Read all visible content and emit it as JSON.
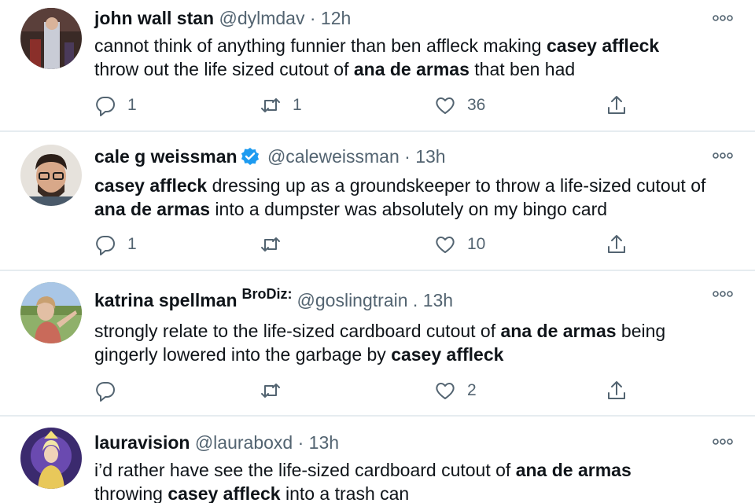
{
  "tweets": [
    {
      "name": "john wall stan",
      "handle": "@dylmdav",
      "separator": "·",
      "time": "12h",
      "verified": false,
      "text_parts": [
        {
          "t": "cannot think of anything funnier than ben affleck making ",
          "b": false
        },
        {
          "t": "casey affleck",
          "b": true
        },
        {
          "t": " throw out the life sized cutout of ",
          "b": false
        },
        {
          "t": "ana de armas",
          "b": true
        },
        {
          "t": " that ben had",
          "b": false
        }
      ],
      "reply_count": "1",
      "retweet_count": "1",
      "like_count": "36"
    },
    {
      "name": "cale g weissman",
      "handle": "@caleweissman",
      "separator": "·",
      "time": "13h",
      "verified": true,
      "text_parts": [
        {
          "t": "casey affleck",
          "b": true
        },
        {
          "t": " dressing up as a groundskeeper to throw a life-sized cutout of ",
          "b": false
        },
        {
          "t": "ana de armas",
          "b": true
        },
        {
          "t": " into a dumpster was absolutely on my bingo card",
          "b": false
        }
      ],
      "reply_count": "1",
      "retweet_count": "",
      "like_count": "10"
    },
    {
      "name": "katrina spellman",
      "overlay_label": "BroDiz:",
      "handle": "@goslingtrain",
      "separator": ".",
      "time": "13h",
      "verified": false,
      "text_parts": [
        {
          "t": "strongly relate to the life-sized cardboard cutout of ",
          "b": false
        },
        {
          "t": "ana de armas",
          "b": true
        },
        {
          "t": " being gingerly lowered into the garbage by ",
          "b": false
        },
        {
          "t": "casey affleck",
          "b": true
        }
      ],
      "reply_count": "",
      "retweet_count": "",
      "like_count": "2"
    },
    {
      "name": "lauravision",
      "handle": "@lauraboxd",
      "separator": "·",
      "time": "13h",
      "verified": false,
      "text_parts": [
        {
          "t": "i’d rather have see the life-sized cardboard cutout of ",
          "b": false
        },
        {
          "t": "ana de armas",
          "b": true
        },
        {
          "t": " throwing ",
          "b": false
        },
        {
          "t": "casey affleck",
          "b": true
        },
        {
          "t": " into a trash can",
          "b": false
        }
      ],
      "reply_count": "",
      "retweet_count": "",
      "like_count": ""
    }
  ],
  "icons": {
    "reply": "reply-icon",
    "retweet": "retweet-icon",
    "like": "heart-icon",
    "share": "share-icon",
    "more": "more-options-icon",
    "verified": "verified-badge-icon"
  },
  "colors": {
    "text": "#0f1419",
    "secondary": "#536471",
    "verified": "#1d9bf0",
    "divider": "#e6ecf0"
  }
}
